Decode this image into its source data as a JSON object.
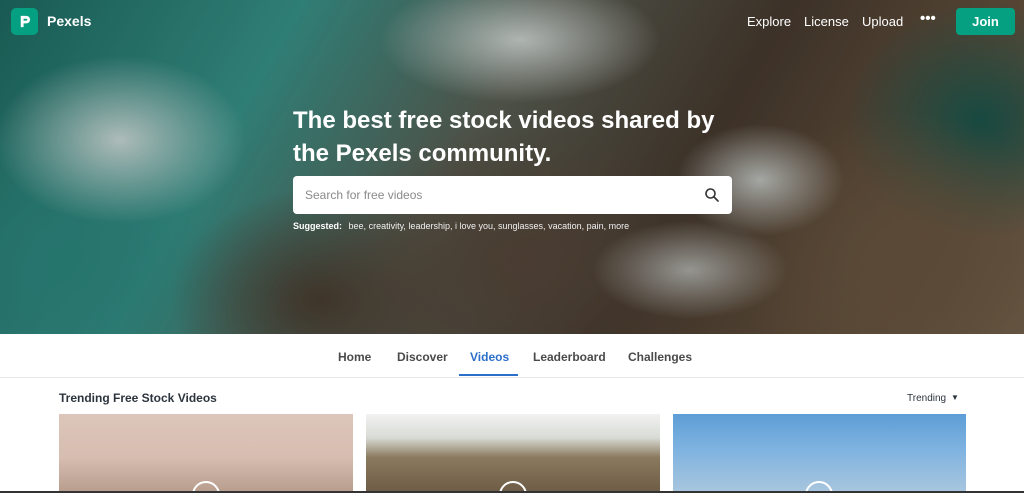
{
  "brand": {
    "name": "Pexels",
    "color": "#05a081"
  },
  "nav": {
    "links": [
      "Explore",
      "License",
      "Upload"
    ],
    "more_label": "•••",
    "join_label": "Join"
  },
  "hero": {
    "headline_line1": "The best free stock videos shared by",
    "headline_line2": "the Pexels community.",
    "search_placeholder": "Search for free videos",
    "suggested_label": "Suggested:",
    "suggested_items": [
      "bee,",
      "creativity,",
      "leadership,",
      "i love you,",
      "sunglasses,",
      "vacation,",
      "pain,",
      "more"
    ]
  },
  "tabs": [
    {
      "label": "Home",
      "active": false
    },
    {
      "label": "Discover",
      "active": false
    },
    {
      "label": "Videos",
      "active": true
    },
    {
      "label": "Leaderboard",
      "active": false
    },
    {
      "label": "Challenges",
      "active": false
    }
  ],
  "section": {
    "title": "Trending Free Stock Videos",
    "sort_label": "Trending",
    "sort_caret": "▼"
  },
  "colors": {
    "accent": "#05a081",
    "active_tab": "#2b6fcb"
  }
}
